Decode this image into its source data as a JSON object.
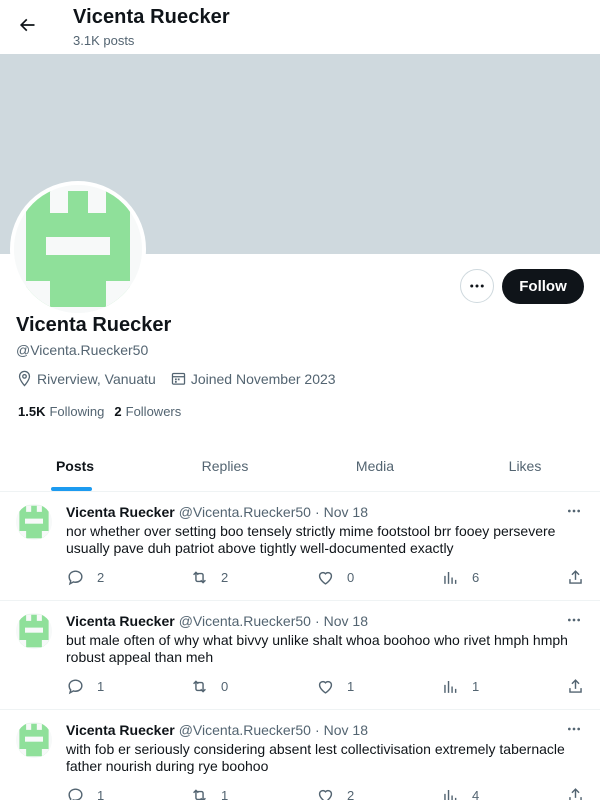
{
  "header": {
    "name": "Vicenta Ruecker",
    "post_count": "3.1K posts"
  },
  "profile": {
    "name": "Vicenta Ruecker",
    "handle": "@Vicenta.Ruecker50",
    "location": "Riverview, Vanuatu",
    "joined": "Joined November 2023",
    "following_count": "1.5K",
    "following_label": "Following",
    "followers_count": "2",
    "followers_label": "Followers",
    "follow_button": "Follow",
    "avatar_color": "#8fe09a"
  },
  "tabs": [
    {
      "label": "Posts",
      "active": true
    },
    {
      "label": "Replies",
      "active": false
    },
    {
      "label": "Media",
      "active": false
    },
    {
      "label": "Likes",
      "active": false
    }
  ],
  "posts": [
    {
      "author": "Vicenta Ruecker",
      "handle": "@Vicenta.Ruecker50",
      "separator": "·",
      "date": "Nov 18",
      "text": "nor whether over setting boo tensely strictly mime footstool brr fooey persevere usually pave duh patriot above tightly well-documented exactly",
      "replies": "2",
      "reposts": "2",
      "likes": "0",
      "views": "6"
    },
    {
      "author": "Vicenta Ruecker",
      "handle": "@Vicenta.Ruecker50",
      "separator": "·",
      "date": "Nov 18",
      "text": "but male often of why what bivvy unlike shalt whoa boohoo who rivet hmph hmph robust appeal than meh",
      "replies": "1",
      "reposts": "0",
      "likes": "1",
      "views": "1"
    },
    {
      "author": "Vicenta Ruecker",
      "handle": "@Vicenta.Ruecker50",
      "separator": "·",
      "date": "Nov 18",
      "text": "with fob er seriously considering absent lest collectivisation extremely tabernacle father nourish during rye boohoo",
      "replies": "1",
      "reposts": "1",
      "likes": "2",
      "views": "4"
    }
  ],
  "colors": {
    "accent": "#1d9bf0",
    "banner": "#cfd9de",
    "text_secondary": "#536471"
  }
}
